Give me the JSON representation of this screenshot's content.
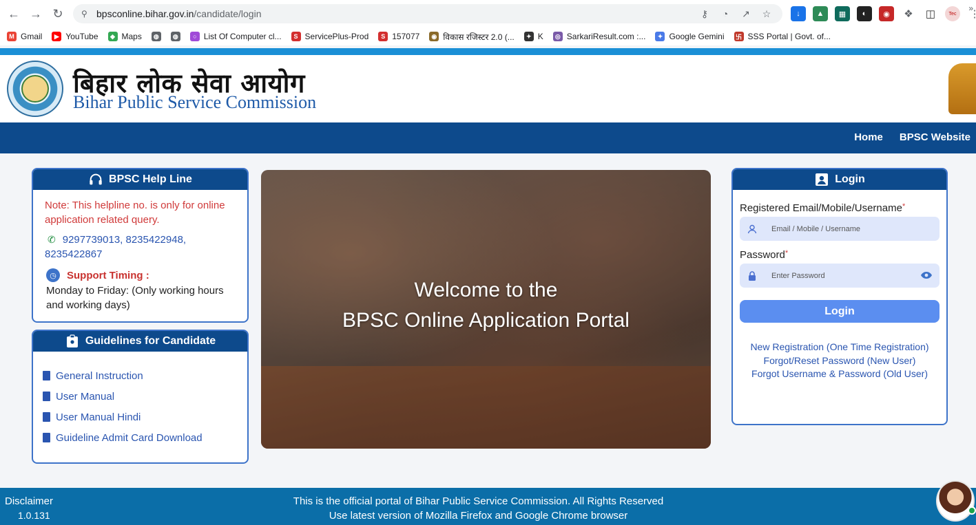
{
  "browser": {
    "url_host": "bpsconline.bihar.gov.in",
    "url_path": "/candidate/login",
    "bookmarks": [
      {
        "label": "Gmail",
        "icon": "gmail-icon",
        "color": "#ea4335",
        "glyph": "M"
      },
      {
        "label": "YouTube",
        "icon": "youtube-icon",
        "color": "#ff0000",
        "glyph": "▶"
      },
      {
        "label": "Maps",
        "icon": "maps-icon",
        "color": "#34a853",
        "glyph": "◆"
      },
      {
        "label": "",
        "icon": "globe-icon",
        "color": "#5f6368",
        "glyph": "◍"
      },
      {
        "label": "",
        "icon": "globe-icon",
        "color": "#5f6368",
        "glyph": "◍"
      },
      {
        "label": "List Of Computer cl...",
        "icon": "bookmark-icon",
        "color": "#a04bd8",
        "glyph": "○"
      },
      {
        "label": "ServicePlus-Prod",
        "icon": "serviceplus-icon",
        "color": "#d32f2f",
        "glyph": "S"
      },
      {
        "label": "157077",
        "icon": "serviceplus-icon",
        "color": "#d32f2f",
        "glyph": "S"
      },
      {
        "label": "विकास रजिस्टर 2.0 (...",
        "icon": "emblem-icon",
        "color": "#8a6a2a",
        "glyph": "◉"
      },
      {
        "label": "K",
        "icon": "bookmark-icon",
        "color": "#333333",
        "glyph": "✦"
      },
      {
        "label": "SarkariResult.com :...",
        "icon": "sarkari-icon",
        "color": "#7a5aa8",
        "glyph": "◎"
      },
      {
        "label": "Google Gemini",
        "icon": "gemini-icon",
        "color": "#4a7ae8",
        "glyph": "✦"
      },
      {
        "label": "SSS Portal | Govt. of...",
        "icon": "sss-icon",
        "color": "#c0392b",
        "glyph": "卐"
      }
    ],
    "bookmarks_more": "»"
  },
  "header": {
    "title_hindi": "बिहार लोक सेवा आयोग",
    "title_english": "Bihar Public Service Commission"
  },
  "nav": {
    "home": "Home",
    "bpsc_website": "BPSC Website"
  },
  "helpline": {
    "title": "BPSC Help Line",
    "note": "Note: This helpline no. is only for online application related query.",
    "phones": "9297739013, 8235422948, 8235422867",
    "support_label": "Support Timing :",
    "support_text": "Monday to Friday: (Only working hours and working days)"
  },
  "guidelines": {
    "title": "Guidelines for Candidate",
    "items": [
      {
        "label": "General Instruction"
      },
      {
        "label": "User Manual"
      },
      {
        "label": "User Manual Hindi"
      },
      {
        "label": "Guideline Admit Card Download"
      }
    ]
  },
  "hero": {
    "line1": "Welcome to the",
    "line2": "BPSC Online Application Portal"
  },
  "login": {
    "title": "Login",
    "username_label": "Registered Email/Mobile/Username",
    "username_placeholder": "Email / Mobile / Username",
    "password_label": "Password",
    "password_placeholder": "Enter Password",
    "required_mark": "*",
    "button": "Login",
    "links": [
      {
        "label": "New Registration (One Time Registration)"
      },
      {
        "label": "Forgot/Reset Password (New User)"
      },
      {
        "label": "Forgot Username & Password (Old User)"
      }
    ]
  },
  "footer": {
    "disclaimer": "Disclaimer",
    "version": "1.0.131",
    "line1": "This is the official portal of Bihar Public Service Commission. All Rights Reserved",
    "line2": "Use latest version of Mozilla Firefox and Google Chrome browser"
  },
  "colors": {
    "navy": "#0d4a8c",
    "accent": "#1a8fd6",
    "footer": "#0b6ea8",
    "note_red": "#d03a3a",
    "link_blue": "#2a55b0"
  }
}
